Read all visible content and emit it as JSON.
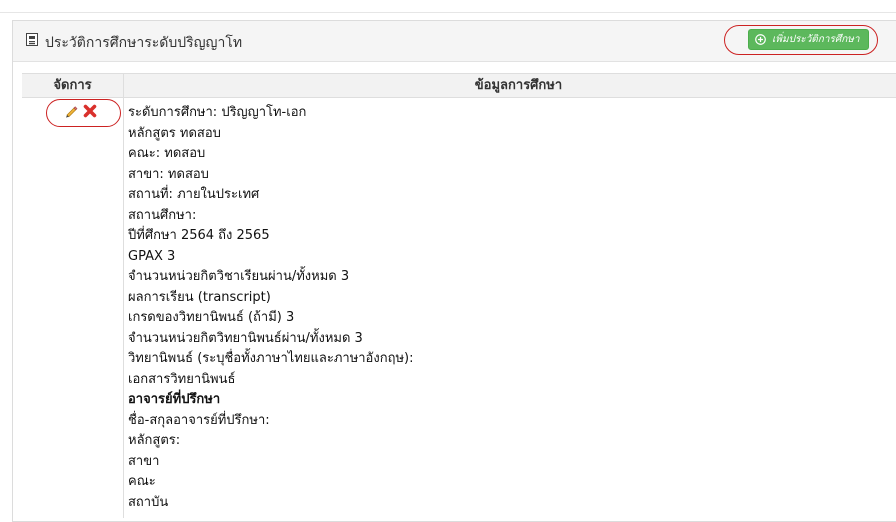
{
  "panel": {
    "title": "ประวัติการศึกษาระดับปริญญาโท",
    "add_button_label": "เพิ่มประวัติการศึกษา"
  },
  "table": {
    "headers": {
      "manage": "จัดการ",
      "info": "ข้อมูลการศึกษา"
    },
    "row": {
      "lines": [
        "ระดับการศึกษา: ปริญญาโท-เอก",
        "หลักสูตร ทดสอบ",
        "คณะ: ทดสอบ",
        "สาขา: ทดสอบ",
        "สถานที่: ภายในประเทศ",
        "สถานศึกษา:",
        "ปีที่ศึกษา 2564 ถึง 2565",
        "GPAX 3",
        "จำนวนหน่วยกิตวิชาเรียนผ่าน/ทั้งหมด 3",
        "ผลการเรียน (transcript)",
        "เกรดของวิทยานิพนธ์ (ถ้ามี) 3",
        "จำนวนหน่วยกิตวิทยานิพนธ์ผ่าน/ทั้งหมด 3",
        "วิทยานิพนธ์ (ระบุชื่อทั้งภาษาไทยและภาษาอังกฤษ):",
        "เอกสารวิทยานิพนธ์",
        "อาจารย์ที่ปรึกษา",
        "ชื่อ-สกุลอาจารย์ที่ปรึกษา:",
        "หลักสูตร:",
        "สาขา",
        "คณะ",
        "สถาบัน"
      ]
    }
  },
  "icons": {
    "header": "document-icon",
    "add": "plus-circle-icon",
    "edit": "pencil-icon",
    "delete": "delete-x-icon"
  },
  "colors": {
    "add_button": "#5cb85c",
    "delete": "#d9302c",
    "edit": "#e3a21a",
    "callout": "#cc2222",
    "header_bg": "#f5f5f5"
  }
}
